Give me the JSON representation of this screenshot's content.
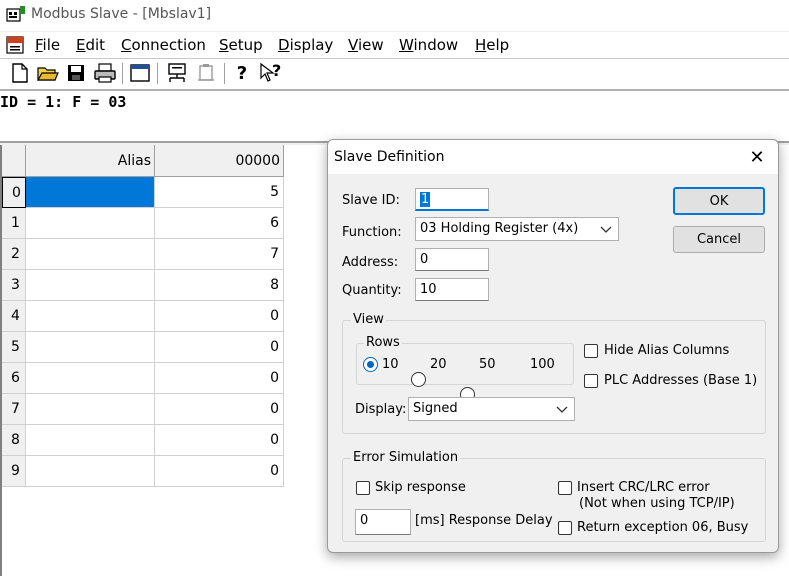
{
  "window": {
    "title": "Modbus Slave - [Mbslav1]"
  },
  "menu": [
    {
      "label": "File",
      "mnemonic": "F",
      "rest": "ile"
    },
    {
      "label": "Edit",
      "mnemonic": "E",
      "rest": "dit"
    },
    {
      "label": "Connection",
      "mnemonic": "C",
      "rest": "onnection"
    },
    {
      "label": "Setup",
      "mnemonic": "S",
      "rest": "etup"
    },
    {
      "label": "Display",
      "mnemonic": "D",
      "rest": "isplay"
    },
    {
      "label": "View",
      "mnemonic": "V",
      "rest": "iew"
    },
    {
      "label": "Window",
      "mnemonic": "W",
      "rest": "indow"
    },
    {
      "label": "Help",
      "mnemonic": "H",
      "rest": "elp"
    }
  ],
  "toolbar": {
    "icons": [
      "new-document-icon",
      "open-folder-icon",
      "save-icon",
      "print-icon",
      "window-icon",
      "connect-icon",
      "disconnect-icon",
      "help-icon",
      "context-help-icon"
    ],
    "help_glyph": "?",
    "context_help_glyph": "?"
  },
  "sheet": {
    "status": "ID = 1: F = 03",
    "columns": [
      "Alias",
      "00000"
    ],
    "rows": [
      {
        "index": "0",
        "alias": "",
        "value": "5"
      },
      {
        "index": "1",
        "alias": "",
        "value": "6"
      },
      {
        "index": "2",
        "alias": "",
        "value": "7"
      },
      {
        "index": "3",
        "alias": "",
        "value": "8"
      },
      {
        "index": "4",
        "alias": "",
        "value": "0"
      },
      {
        "index": "5",
        "alias": "",
        "value": "0"
      },
      {
        "index": "6",
        "alias": "",
        "value": "0"
      },
      {
        "index": "7",
        "alias": "",
        "value": "0"
      },
      {
        "index": "8",
        "alias": "",
        "value": "0"
      },
      {
        "index": "9",
        "alias": "",
        "value": "0"
      }
    ],
    "selected_color": "#0078d7"
  },
  "dialog": {
    "title": "Slave Definition",
    "close_glyph": "✕",
    "slave_id_label": "Slave ID:",
    "slave_id_value": "1",
    "function_label": "Function:",
    "function_value": "03 Holding Register (4x)",
    "address_label": "Address:",
    "address_value": "0",
    "quantity_label": "Quantity:",
    "quantity_value": "10",
    "ok_label": "OK",
    "cancel_label": "Cancel",
    "view_group": "View",
    "rows_group": "Rows",
    "row_options": [
      {
        "label": "10",
        "selected": true
      },
      {
        "label": "20",
        "selected": false
      },
      {
        "label": "50",
        "selected": false
      },
      {
        "label": "100",
        "selected": false
      }
    ],
    "hide_alias_label": "Hide Alias Columns",
    "plc_addresses_label": "PLC Addresses (Base 1)",
    "display_label": "Display:",
    "display_value": "Signed",
    "error_group": "Error Simulation",
    "skip_response_label": "Skip response",
    "crc_error_label": "Insert CRC/LRC error",
    "crc_error_note": "(Not when using TCP/IP)",
    "response_delay_value": "0",
    "response_delay_label": "[ms] Response Delay",
    "busy_label": "Return exception 06, Busy"
  }
}
